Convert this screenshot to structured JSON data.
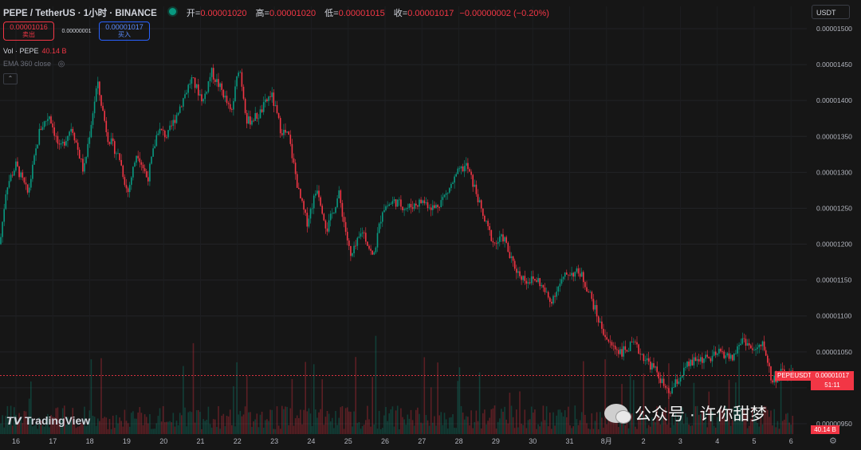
{
  "header": {
    "symbol": "PEPE / TetherUS · 1小时 · BINANCE",
    "open_label": "开=",
    "open": "0.00001020",
    "high_label": "高=",
    "high": "0.00001020",
    "low_label": "低=",
    "low": "0.00001015",
    "close_label": "收=",
    "close": "0.00001017",
    "change": "−0.00000002 (−0.20%)"
  },
  "trade": {
    "sell_price": "0.00001016",
    "sell_label": "卖出",
    "spread": "0.00000001",
    "buy_price": "0.00001017",
    "buy_label": "买入"
  },
  "indicators": {
    "vol_label": "Vol · PEPE",
    "vol_value": "40.14 B",
    "ema_label": "EMA 360 close"
  },
  "currency": "USDT",
  "last_price_tag": {
    "symbol": "PEPEUSDT",
    "price": "0.00001017",
    "countdown": "51:11",
    "volume": "40.14 B"
  },
  "branding": {
    "logo_text": "TradingView",
    "watermark_text": "公众号 · 许你甜梦"
  },
  "colors": {
    "up": "#089981",
    "down": "#f23645",
    "background": "#161616"
  },
  "chart_data": {
    "type": "candlestick",
    "y_ticks": [
      "0.00001500",
      "0.00001450",
      "0.00001400",
      "0.00001350",
      "0.00001300",
      "0.00001250",
      "0.00001200",
      "0.00001150",
      "0.00001100",
      "0.00001050",
      "0.00001000",
      "0.00000950"
    ],
    "ylim": [
      9.5e-06,
      1.51e-05
    ],
    "x_ticks": [
      "16",
      "17",
      "18",
      "19",
      "20",
      "21",
      "22",
      "23",
      "24",
      "25",
      "26",
      "27",
      "28",
      "29",
      "30",
      "31",
      "8月",
      "2",
      "3",
      "4",
      "5",
      "6"
    ],
    "last_close": 1.017e-05,
    "series": [
      {
        "name": "PEPE / TetherUS",
        "approx_close_path": [
          [
            0,
            1200
          ],
          [
            8,
            1280
          ],
          [
            20,
            1310
          ],
          [
            35,
            1270
          ],
          [
            50,
            1360
          ],
          [
            62,
            1380
          ],
          [
            75,
            1330
          ],
          [
            90,
            1365
          ],
          [
            105,
            1300
          ],
          [
            122,
            1425
          ],
          [
            135,
            1350
          ],
          [
            150,
            1320
          ],
          [
            160,
            1270
          ],
          [
            172,
            1330
          ],
          [
            185,
            1290
          ],
          [
            198,
            1360
          ],
          [
            210,
            1350
          ],
          [
            225,
            1390
          ],
          [
            240,
            1430
          ],
          [
            255,
            1400
          ],
          [
            265,
            1440
          ],
          [
            280,
            1410
          ],
          [
            290,
            1380
          ],
          [
            300,
            1450
          ],
          [
            310,
            1370
          ],
          [
            325,
            1380
          ],
          [
            340,
            1410
          ],
          [
            352,
            1360
          ],
          [
            362,
            1350
          ],
          [
            375,
            1270
          ],
          [
            385,
            1230
          ],
          [
            398,
            1280
          ],
          [
            410,
            1220
          ],
          [
            425,
            1270
          ],
          [
            440,
            1180
          ],
          [
            455,
            1220
          ],
          [
            468,
            1180
          ],
          [
            480,
            1250
          ],
          [
            495,
            1260
          ],
          [
            510,
            1250
          ],
          [
            530,
            1260
          ],
          [
            545,
            1250
          ],
          [
            560,
            1270
          ],
          [
            575,
            1300
          ],
          [
            585,
            1310
          ],
          [
            598,
            1270
          ],
          [
            605,
            1240
          ],
          [
            620,
            1200
          ],
          [
            632,
            1210
          ],
          [
            640,
            1180
          ],
          [
            650,
            1160
          ],
          [
            660,
            1150
          ],
          [
            675,
            1150
          ],
          [
            690,
            1120
          ],
          [
            700,
            1140
          ],
          [
            712,
            1160
          ],
          [
            728,
            1160
          ],
          [
            740,
            1130
          ],
          [
            752,
            1090
          ],
          [
            765,
            1060
          ],
          [
            780,
            1050
          ],
          [
            795,
            1060
          ],
          [
            810,
            1040
          ],
          [
            825,
            1020
          ],
          [
            838,
            990
          ],
          [
            850,
            1010
          ],
          [
            862,
            1030
          ],
          [
            875,
            1040
          ],
          [
            890,
            1040
          ],
          [
            905,
            1050
          ],
          [
            918,
            1040
          ],
          [
            932,
            1070
          ],
          [
            945,
            1050
          ],
          [
            958,
            1060
          ],
          [
            968,
            1010
          ],
          [
            980,
            1020
          ],
          [
            995,
            1017
          ]
        ]
      }
    ],
    "volume_note": "volume bars along bottom pane"
  }
}
